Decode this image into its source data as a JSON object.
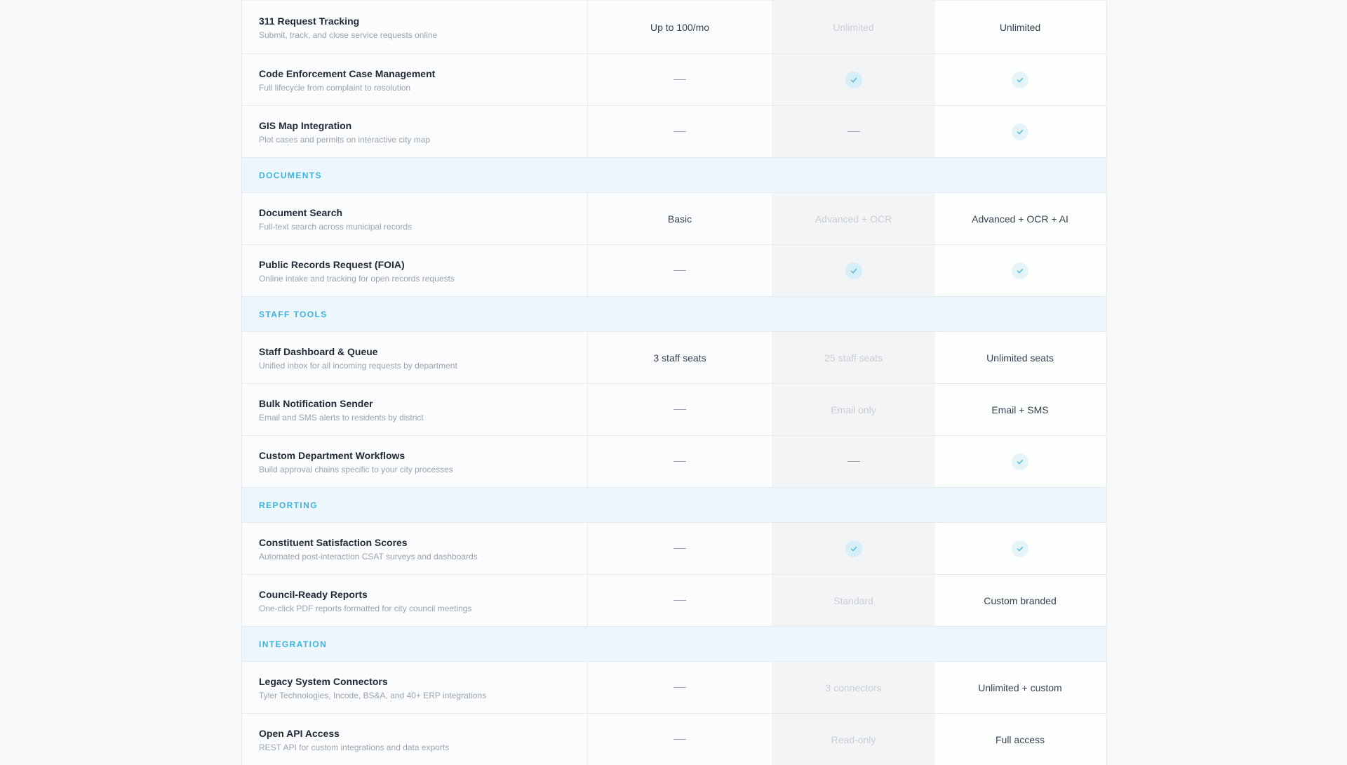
{
  "sections": [
    {
      "title": "",
      "rows": [
        {
          "name": "311 Request Tracking",
          "desc": "Submit, track, and close service requests online",
          "basic": {
            "type": "text",
            "value": "Up to 100/mo"
          },
          "mid": {
            "type": "text",
            "value": "Unlimited"
          },
          "top": {
            "type": "text",
            "value": "Unlimited"
          }
        },
        {
          "name": "Code Enforcement Case Management",
          "desc": "Full lifecycle from complaint to resolution",
          "basic": {
            "type": "dash"
          },
          "mid": {
            "type": "check"
          },
          "top": {
            "type": "check"
          }
        },
        {
          "name": "GIS Map Integration",
          "desc": "Plot cases and permits on interactive city map",
          "basic": {
            "type": "dash"
          },
          "mid": {
            "type": "dash"
          },
          "top": {
            "type": "check"
          }
        }
      ]
    },
    {
      "title": "DOCUMENTS",
      "rows": [
        {
          "name": "Document Search",
          "desc": "Full-text search across municipal records",
          "basic": {
            "type": "text",
            "value": "Basic"
          },
          "mid": {
            "type": "text",
            "value": "Advanced + OCR"
          },
          "top": {
            "type": "text",
            "value": "Advanced + OCR + AI"
          }
        },
        {
          "name": "Public Records Request (FOIA)",
          "desc": "Online intake and tracking for open records requests",
          "basic": {
            "type": "dash"
          },
          "mid": {
            "type": "check"
          },
          "top": {
            "type": "check"
          }
        }
      ]
    },
    {
      "title": "STAFF TOOLS",
      "rows": [
        {
          "name": "Staff Dashboard & Queue",
          "desc": "Unified inbox for all incoming requests by department",
          "basic": {
            "type": "text",
            "value": "3 staff seats"
          },
          "mid": {
            "type": "text",
            "value": "25 staff seats"
          },
          "top": {
            "type": "text",
            "value": "Unlimited seats"
          }
        },
        {
          "name": "Bulk Notification Sender",
          "desc": "Email and SMS alerts to residents by district",
          "basic": {
            "type": "dash"
          },
          "mid": {
            "type": "text",
            "value": "Email only"
          },
          "top": {
            "type": "text",
            "value": "Email + SMS"
          }
        },
        {
          "name": "Custom Department Workflows",
          "desc": "Build approval chains specific to your city processes",
          "basic": {
            "type": "dash"
          },
          "mid": {
            "type": "dash"
          },
          "top": {
            "type": "check"
          }
        }
      ]
    },
    {
      "title": "REPORTING",
      "rows": [
        {
          "name": "Constituent Satisfaction Scores",
          "desc": "Automated post-interaction CSAT surveys and dashboards",
          "basic": {
            "type": "dash"
          },
          "mid": {
            "type": "check"
          },
          "top": {
            "type": "check"
          }
        },
        {
          "name": "Council-Ready Reports",
          "desc": "One-click PDF reports formatted for city council meetings",
          "basic": {
            "type": "dash"
          },
          "mid": {
            "type": "text",
            "value": "Standard"
          },
          "top": {
            "type": "text",
            "value": "Custom branded"
          }
        }
      ]
    },
    {
      "title": "INTEGRATION",
      "rows": [
        {
          "name": "Legacy System Connectors",
          "desc": "Tyler Technologies, Incode, BS&A, and 40+ ERP integrations",
          "basic": {
            "type": "dash"
          },
          "mid": {
            "type": "text",
            "value": "3 connectors"
          },
          "top": {
            "type": "text",
            "value": "Unlimited + custom"
          }
        },
        {
          "name": "Open API Access",
          "desc": "REST API for custom integrations and data exports",
          "basic": {
            "type": "dash"
          },
          "mid": {
            "type": "text",
            "value": "Read-only"
          },
          "top": {
            "type": "text",
            "value": "Full access"
          }
        }
      ]
    }
  ],
  "colors": {
    "section_label": "#3bb3dc",
    "check_stroke": "#3bb3dc",
    "check_bg_mid": "#d6eef8",
    "check_bg_top": "#e6f4fa"
  }
}
